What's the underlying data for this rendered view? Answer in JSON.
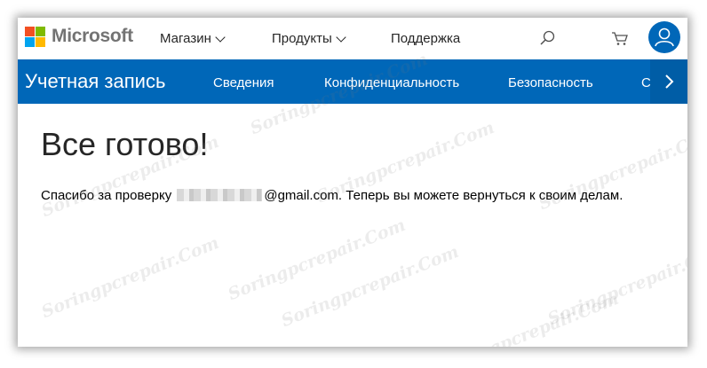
{
  "header": {
    "brand": "Microsoft",
    "nav": [
      {
        "label": "Магазин",
        "has_dropdown": true
      },
      {
        "label": "Продукты",
        "has_dropdown": true
      },
      {
        "label": "Поддержка",
        "has_dropdown": false
      }
    ],
    "icons": [
      "search-icon",
      "cart-icon",
      "user-avatar-icon"
    ]
  },
  "account_bar": {
    "title": "Учетная запись",
    "links": [
      "Сведения",
      "Конфиденциальность",
      "Безопасность",
      "С"
    ]
  },
  "content": {
    "heading": "Все готово!",
    "message_prefix": "Спасибо за проверку",
    "message_email_domain": "@gmail.com.",
    "message_suffix": "Теперь вы можете вернуться к своим делам."
  },
  "watermark": "Soringpcrepair.Com",
  "colors": {
    "brand_blue": "#0067b8",
    "logo_red": "#f25022",
    "logo_green": "#7fba00",
    "logo_blue": "#00a4ef",
    "logo_yellow": "#ffb900"
  }
}
